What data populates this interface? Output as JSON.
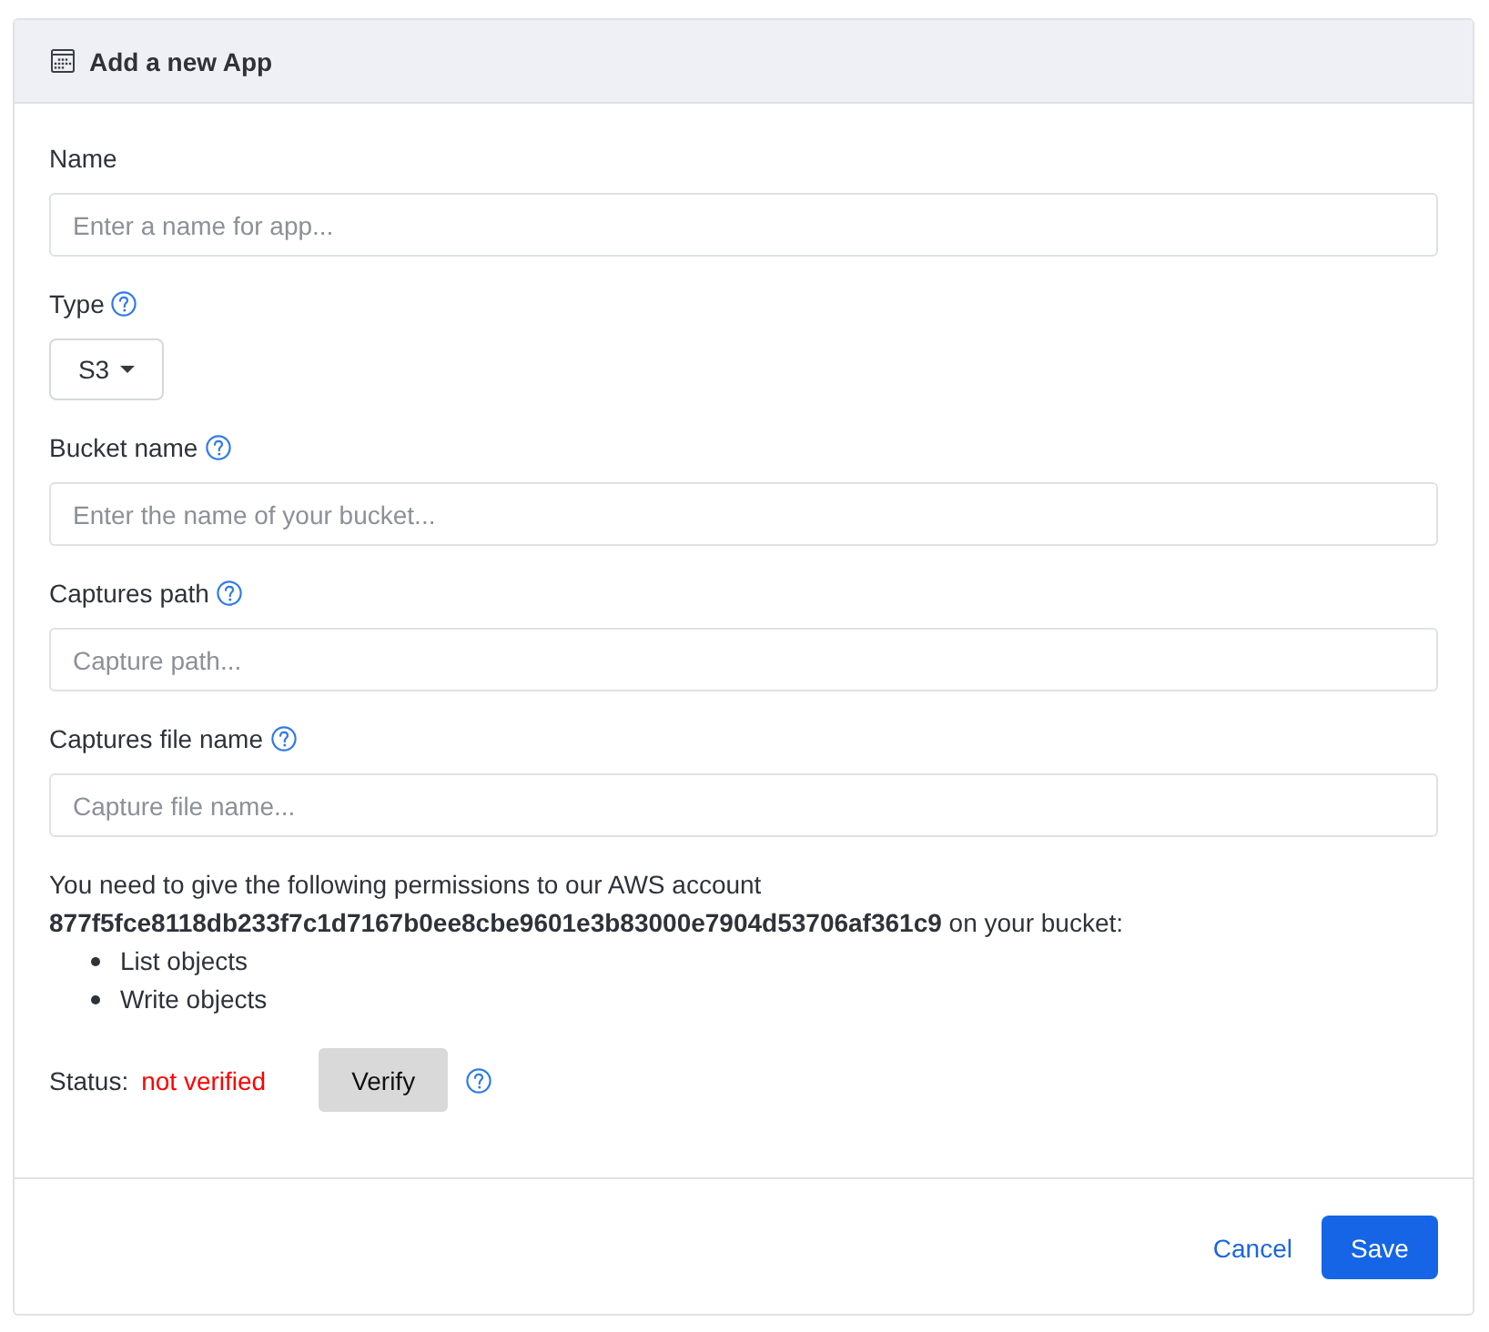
{
  "card": {
    "title": "Add a new App"
  },
  "fields": [
    {
      "kind": "text",
      "label": "Name",
      "help": false,
      "placeholder": "Enter a name for app..."
    },
    {
      "kind": "dropdown",
      "label": "Type",
      "help": true,
      "value": "S3"
    },
    {
      "kind": "text",
      "label": "Bucket name",
      "help": true,
      "placeholder": "Enter the name of your bucket..."
    },
    {
      "kind": "text",
      "label": "Captures path",
      "help": true,
      "placeholder": "Capture path..."
    },
    {
      "kind": "text",
      "label": "Captures file name",
      "help": true,
      "placeholder": "Capture file name..."
    }
  ],
  "permissions": {
    "text": "You need to give the following permissions to our AWS account **877f5fce8118db233f7c1d7167b0ee8cbe9601e3b83000e7904d53706af361c9** on your bucket:",
    "items": [
      "List objects",
      "Write objects"
    ]
  },
  "status": {
    "label": "Status:",
    "value": "not verified",
    "verified": false,
    "button": "Verify",
    "help": true
  },
  "footer": {
    "buttons": [
      {
        "kind": "link",
        "label": "Cancel"
      },
      {
        "kind": "primary",
        "label": "Save"
      }
    ]
  }
}
